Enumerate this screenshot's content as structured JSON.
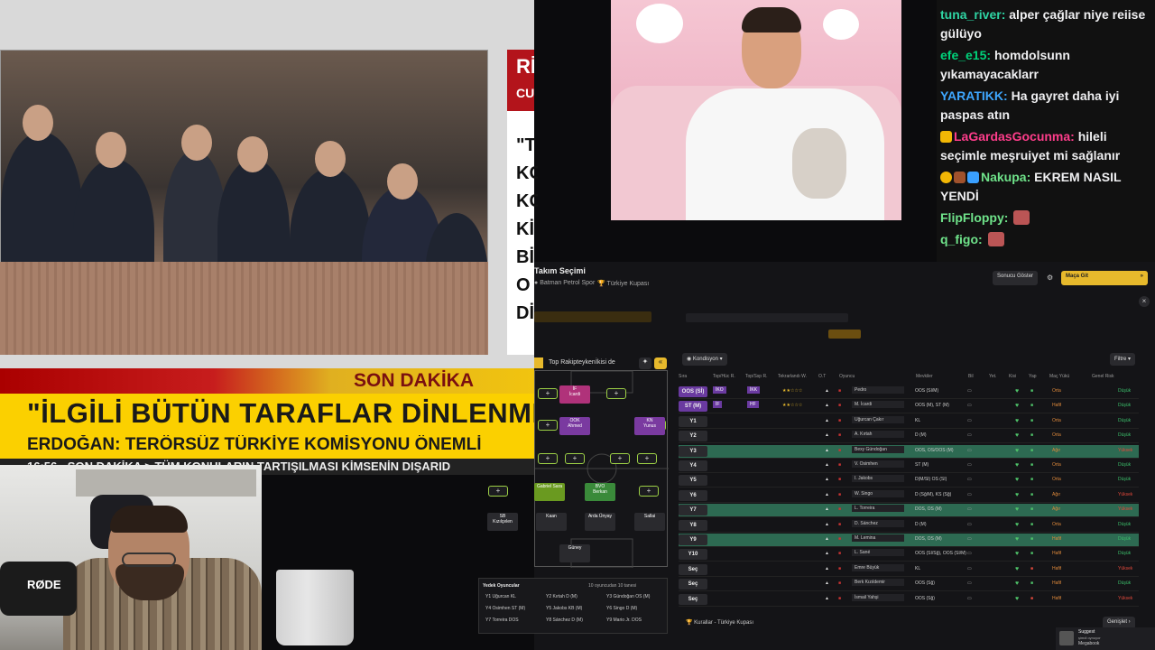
{
  "news": {
    "side_badge": "Rİ",
    "side_sub": "CU",
    "side_lines": [
      "\"T",
      "KC",
      "KC",
      "Kİ",
      "Bİ",
      "O",
      "Dİ"
    ],
    "son_dakika": "SON DAKİKA",
    "headline": "\"İLGİLİ BÜTÜN TARAFLAR DİNLENME",
    "subline": "ERDOĞAN: TERÖRSÜZ TÜRKİYE KOMİSYONU ÖNEMLİ",
    "ticker": "16:56 · SON DAKİKA > TÜM KONULARIN TARTIŞILMASI KİMSENİN DIŞARID"
  },
  "webcam": {
    "mic_brand": "RØDE"
  },
  "chat": {
    "messages": [
      {
        "user": "tuna_river",
        "color": "#2fd4a3",
        "text": "alper çağlar niye reiise gülüyo",
        "badges": [],
        "emote": false
      },
      {
        "user": "efe_e15",
        "color": "#00d27a",
        "text": "homdolsunn yıkamayacaklarr",
        "badges": [],
        "emote": false
      },
      {
        "user": "YARATIKK",
        "color": "#3ea7ff",
        "text": "Ha gayret daha iyi paspas atın",
        "badges": [],
        "emote": false
      },
      {
        "user": "LaGardasGocunma",
        "color": "#ff3d8b",
        "text": "hileli seçimle meşruiyet mi sağlanır",
        "badges": [
          "#f2b705"
        ],
        "emote": false
      },
      {
        "user": "Nakupa",
        "color": "#6fe38a",
        "text": "EKREM NASIL YENDİ",
        "badges": [
          "#f2b705",
          "#a0522d",
          "#3aa0ff"
        ],
        "emote": false
      },
      {
        "user": "FlipFloppy",
        "color": "#6fe38a",
        "text": "",
        "badges": [],
        "emote": true
      },
      {
        "user": "q_figo",
        "color": "#6fe38a",
        "text": "",
        "badges": [],
        "emote": true
      }
    ]
  },
  "game": {
    "title": "Takım Seçimi",
    "club": "Batman Petrol Spor",
    "competition": "Türkiye Kupası",
    "show_button": "Sonucu Göster",
    "continue_button": "Maça Git",
    "tabs": [
      "Top Rakipteyken",
      "İkisi de"
    ],
    "condition_dropdown": "Kondisyon",
    "filter_button": "Filtre",
    "columns": [
      "Sıra",
      "Top/Hüc R.",
      "Top/Ssp R.",
      "Tekrarlandı W.",
      "O.T",
      "Oyuncu",
      "Mevkiler",
      "Bil",
      "Yet.",
      "Kisi",
      "Yap",
      "Maç Yükü",
      "Genel Risk"
    ],
    "rows": [
      {
        "pos": "OOS (Sİ)",
        "r1": "İKO",
        "r2": "İKK",
        "player": "Pedro",
        "mevki": "OOS (Sİ/M)",
        "yuk": "Orta",
        "risk": "Düşük",
        "risk_color": "#3cbf6b",
        "hl": false
      },
      {
        "pos": "ST (M)",
        "r1": "İF",
        "r2": "HF",
        "player": "M. İcardi",
        "mevki": "OOS (M), ST (M)",
        "yuk": "Hafif",
        "risk": "Düşük",
        "risk_color": "#3cbf6b",
        "hl": false
      },
      {
        "pos": "Y1",
        "r1": "",
        "r2": "",
        "player": "Uğurcan Çakır",
        "mevki": "KL",
        "yuk": "Orta",
        "risk": "Düşük",
        "risk_color": "#3cbf6b",
        "hl": false
      },
      {
        "pos": "Y2",
        "r1": "",
        "r2": "",
        "player": "A. Kırtah",
        "mevki": "D (M)",
        "yuk": "Orta",
        "risk": "Düşük",
        "risk_color": "#3cbf6b",
        "hl": false
      },
      {
        "pos": "Y3",
        "r1": "",
        "r2": "",
        "player": "Bexy Gündoğan",
        "mevki": "OOS, OS/OOS (M)",
        "yuk": "Ağır",
        "risk": "Yüksek",
        "risk_color": "#e0483b",
        "hl": true
      },
      {
        "pos": "Y4",
        "r1": "",
        "r2": "",
        "player": "V. Osimhen",
        "mevki": "ST (M)",
        "yuk": "Orta",
        "risk": "Düşük",
        "risk_color": "#3cbf6b",
        "hl": false
      },
      {
        "pos": "Y5",
        "r1": "",
        "r2": "",
        "player": "I. Jakobs",
        "mevki": "D(M/Sİ) OS (Sİ)",
        "yuk": "Orta",
        "risk": "Düşük",
        "risk_color": "#3cbf6b",
        "hl": false
      },
      {
        "pos": "Y6",
        "r1": "",
        "r2": "",
        "player": "W. Singo",
        "mevki": "D (Sğ/M), KS (Sğ)",
        "yuk": "Ağır",
        "risk": "Yüksek",
        "risk_color": "#e0483b",
        "hl": false
      },
      {
        "pos": "Y7",
        "r1": "",
        "r2": "",
        "player": "L. Torreira",
        "mevki": "DOS, OS (M)",
        "yuk": "Ağır",
        "risk": "Yüksek",
        "risk_color": "#e0483b",
        "hl": true
      },
      {
        "pos": "Y8",
        "r1": "",
        "r2": "",
        "player": "D. Sánchez",
        "mevki": "D (M)",
        "yuk": "Orta",
        "risk": "Düşük",
        "risk_color": "#3cbf6b",
        "hl": false
      },
      {
        "pos": "Y9",
        "r1": "",
        "r2": "",
        "player": "M. Lemina",
        "mevki": "DOS, OS (M)",
        "yuk": "Hafif",
        "risk": "Düşük",
        "risk_color": "#3cbf6b",
        "hl": true
      },
      {
        "pos": "Y10",
        "r1": "",
        "r2": "",
        "player": "L. Sané",
        "mevki": "OOS (Sİ/Sğ), OOS (Sİ/M)",
        "yuk": "Hafif",
        "risk": "Düşük",
        "risk_color": "#3cbf6b",
        "hl": false
      },
      {
        "pos": "Seç",
        "r1": "",
        "r2": "",
        "player": "Emre Büyük",
        "mevki": "KL",
        "yuk": "Hafif",
        "risk": "Yüksek",
        "risk_color": "#e0483b",
        "hl": false
      },
      {
        "pos": "Seç",
        "r1": "",
        "r2": "",
        "player": "Berk Kızıldemir",
        "mevki": "OOS (Sğ)",
        "yuk": "Hafif",
        "risk": "Düşük",
        "risk_color": "#3cbf6b",
        "hl": false
      },
      {
        "pos": "Seç",
        "r1": "",
        "r2": "",
        "player": "İsmail Yahşi",
        "mevki": "OOS (Sğ)",
        "yuk": "Hafif",
        "risk": "Yüksek",
        "risk_color": "#e0483b",
        "hl": false
      }
    ],
    "pitch_players": [
      {
        "role": "İF",
        "name": "İcardi",
        "color": "#b0327a"
      },
      {
        "role": "OOK",
        "name": "Ahmed",
        "color": "#7a3aa0"
      },
      {
        "role": "KN",
        "name": "Yunus",
        "color": "#7a3aa0"
      },
      {
        "role": "",
        "name": "Gabriel Sara",
        "color": "#6a9a20"
      },
      {
        "role": "BVO",
        "name": "Berkan",
        "color": "#3a8a3a"
      },
      {
        "role": "SB",
        "name": "Kızılçelen",
        "color": "#b33"
      },
      {
        "role": "",
        "name": "Kaan",
        "color": "#b33"
      },
      {
        "role": "",
        "name": "Arda Ünyay",
        "color": "#b33"
      },
      {
        "role": "",
        "name": "Sallai",
        "color": "#b33"
      },
      {
        "role": "",
        "name": "Güney",
        "color": "#b33"
      }
    ],
    "bench_title": "Yedek Oyuncular",
    "bench_info": "10 oyuncudan 10 tanesi",
    "bench": [
      [
        "Y1",
        "Uğurcan",
        "KL"
      ],
      [
        "Y2",
        "Kırtah",
        "D (M)"
      ],
      [
        "Y3",
        "Gündoğan",
        "OS (M)"
      ],
      [
        "Y4",
        "Osimhen",
        "ST (M)"
      ],
      [
        "Y5",
        "Jakobs",
        "KB (M)"
      ],
      [
        "Y6",
        "Singo",
        "D (M)"
      ],
      [
        "Y7",
        "Torreira",
        "DOS"
      ],
      [
        "Y8",
        "Sánchez",
        "D (M)"
      ],
      [
        "Y9",
        "Mario Jr.",
        "DOS"
      ]
    ],
    "footer_label": "Kurallar - Türkiye Kupası",
    "footer_button": "Genişlet",
    "notif_title": "Suggest",
    "notif_sub": "şimdi oynuyor",
    "notif_game": "Megabook"
  }
}
